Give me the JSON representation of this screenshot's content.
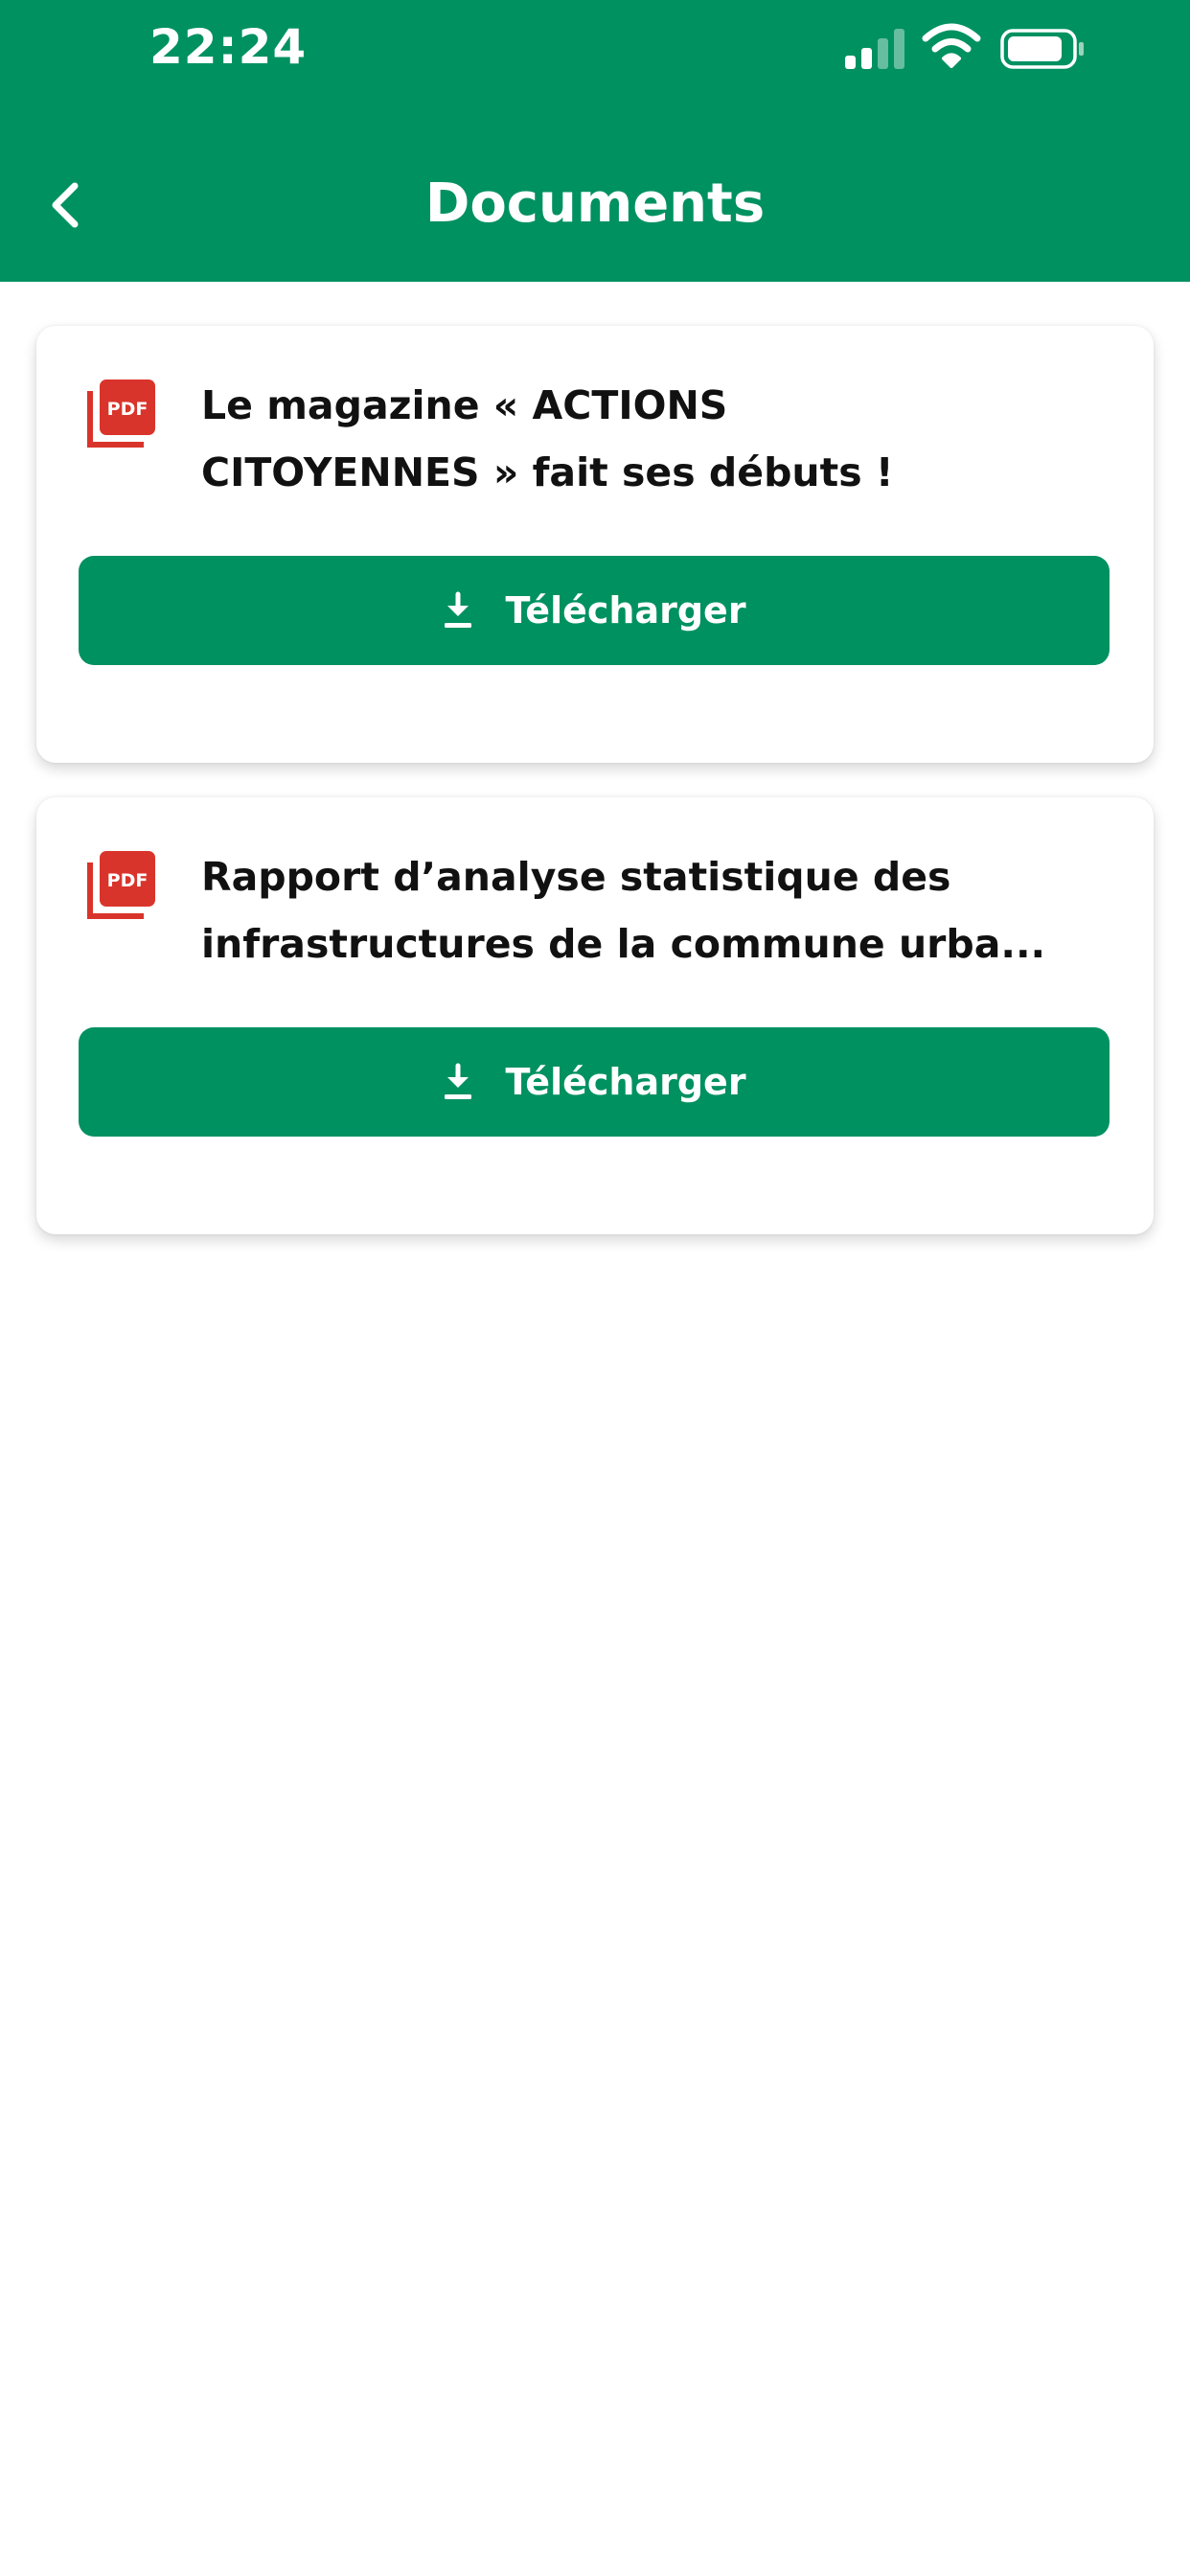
{
  "status_bar": {
    "time": "22:24",
    "signal_icon": "cellular-signal-icon",
    "wifi_icon": "wifi-icon",
    "battery_icon": "battery-icon"
  },
  "header": {
    "back_icon": "chevron-left-icon",
    "title": "Documents",
    "background_color": "#009160"
  },
  "documents": [
    {
      "icon": "pdf-icon",
      "title": "Le magazine « ACTIONS\nCITOYENNES » fait ses débuts !",
      "button_label": "Télécharger",
      "button_icon": "download-icon"
    },
    {
      "icon": "pdf-icon",
      "title": "Rapport d’analyse statistique des\ninfrastructures de la commune urba...",
      "button_label": "Télécharger",
      "button_icon": "download-icon"
    }
  ],
  "colors": {
    "accent": "#009160",
    "pdf_red": "#d9342b",
    "text": "#111111"
  }
}
